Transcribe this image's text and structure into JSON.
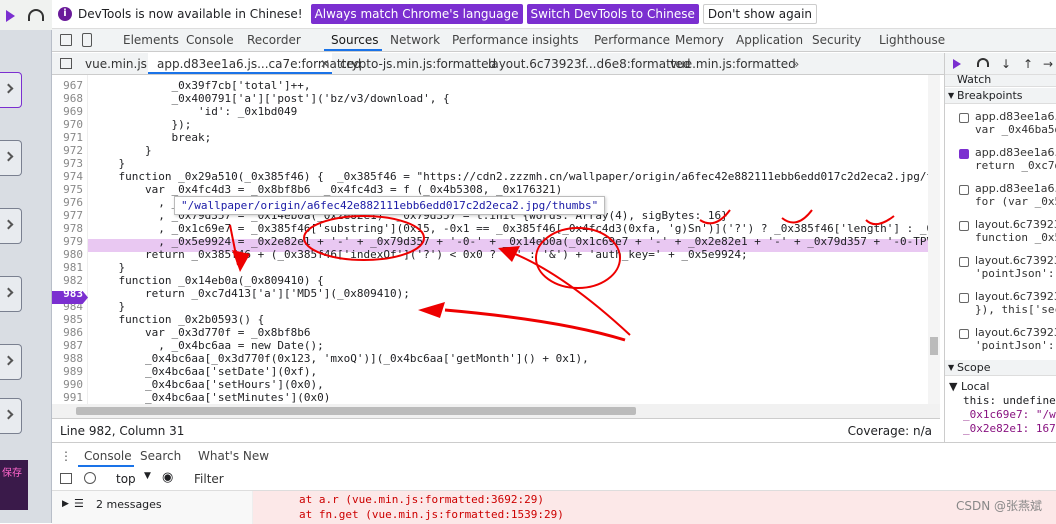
{
  "infobar": {
    "message": "DevTools is now available in Chinese!",
    "btn1": "Always match Chrome's language",
    "btn2": "Switch DevTools to Chinese",
    "btn3": "Don't show again"
  },
  "panels": [
    "Elements",
    "Console",
    "Recorder",
    "Sources",
    "Network",
    "Performance insights",
    "Performance",
    "Memory",
    "Application",
    "Security",
    "Lighthouse"
  ],
  "files": [
    "vue.min.js",
    "app.d83ee1a6.js...ca7e:formatted",
    "crypto-js.min.js:formatted",
    "layout.6c73923f...d6e8:formatted",
    "vue.min.js:formatted"
  ],
  "code": {
    "lines": [
      {
        "n": "967",
        "t": "            _0x39f7cb['total']++,"
      },
      {
        "n": "968",
        "t": "            _0x400791['a']['post']('bz/v3/download', {"
      },
      {
        "n": "969",
        "t": "                'id': _0x1bd049"
      },
      {
        "n": "970",
        "t": "            });"
      },
      {
        "n": "971",
        "t": "            break;"
      },
      {
        "n": "972",
        "t": "        }"
      },
      {
        "n": "973",
        "t": "    }"
      },
      {
        "n": "974",
        "t": "    function _0x29a510(_0x385f46) {  _0x385f46 = \"https://cdn2.zzzmh.cn/wallpaper/origin/a6fec42e882111ebb6edd017c2d2eca2.jpg/thumbs\""
      },
      {
        "n": "975",
        "t": "        var _0x4fc4d3 = _0x8bf8b6  _0x4fc4d3 = f (_0x4b5308, _0x176321)"
      },
      {
        "n": "976",
        "t": "          , _0x2e82e1 = +new Date() ... 73712000\""
      },
      {
        "n": "977",
        "t": "          , _0x79d357 = _0x14eb0a(_0x2e82e1)  _0x79d357 = t.init {words: Array(4), sigBytes: 16}"
      },
      {
        "n": "978",
        "t": "          , _0x1c69e7 = _0x385f46['substring'](0x15, -0x1 == _0x385f46[_0x4fc4d3(0xfa, 'g)Sn')]('?') ? _0x385f46['length'] : _0x385f46['l"
      },
      {
        "n": "979",
        "t": "          , _0x5e9924 = _0x2e82e1 + '-' + _0x79d357 + '-0-' + _0x14eb0a(_0x1c69e7 + '-' + _0x2e82e1 + '-' + _0x79d357 + '-0-TPV4hi7wIeM7D"
      },
      {
        "n": "980",
        "t": "        return _0x385f46 + (_0x385f46['indexOf']('?') < 0x0 ? '?' : '&') + 'auth_key=' + _0x5e9924;"
      },
      {
        "n": "981",
        "t": "    }"
      },
      {
        "n": "982",
        "t": "    function _0x14eb0a(_0x809410) {"
      },
      {
        "n": "983",
        "t": "        return _0xc7d413['a']['MD5'](_0x809410);"
      },
      {
        "n": "984",
        "t": "    }"
      },
      {
        "n": "985",
        "t": "    function _0x2b0593() {"
      },
      {
        "n": "986",
        "t": "        var _0x3d770f = _0x8bf8b6"
      },
      {
        "n": "987",
        "t": "          , _0x4bc6aa = new Date();"
      },
      {
        "n": "988",
        "t": "        _0x4bc6aa[_0x3d770f(0x123, 'mxoQ')](_0x4bc6aa['getMonth']() + 0x1),"
      },
      {
        "n": "989",
        "t": "        _0x4bc6aa['setDate'](0xf),"
      },
      {
        "n": "990",
        "t": "        _0x4bc6aa['setHours'](0x0),"
      },
      {
        "n": "991",
        "t": "        _0x4bc6aa['setMinutes'](0x0)"
      }
    ],
    "tooltip": "\"/wallpaper/origin/a6fec42e882111ebb6edd017c2d2eca2.jpg/thumbs\""
  },
  "status": {
    "position": "Line 982, Column 31",
    "coverage": "Coverage: n/a"
  },
  "right": {
    "watch": "Watch",
    "breakpoints": "Breakpoints",
    "items": [
      {
        "file": "app.d83ee1a6.js?_",
        "code": "var _0x46ba5d",
        "checked": false
      },
      {
        "file": "app.d83ee1a6.js?_",
        "code": "return _0xc7d4",
        "checked": true
      },
      {
        "file": "app.d83ee1a6.js?_",
        "code": "for (var _0x5",
        "checked": false
      },
      {
        "file": "layout.6c73923f.js",
        "code": "function _0x5b",
        "checked": false
      },
      {
        "file": "layout.6c73923f.js",
        "code": "'pointJson': t",
        "checked": false
      },
      {
        "file": "layout.6c73923f.js",
        "code": "}), this['secr",
        "checked": false
      },
      {
        "file": "layout.6c73923f.js",
        "code": "'pointJson': _",
        "checked": false
      }
    ],
    "scope": "Scope",
    "local": "Local",
    "vars": [
      "this: undefined",
      "_0x1c69e7: \"/wal",
      "_0x2e82e1: 1673"
    ]
  },
  "drawer": {
    "tabs": [
      "Console",
      "Search",
      "What's New"
    ],
    "context": "top",
    "filter": "Filter",
    "messages": "2 messages",
    "err1": "at a.r (vue.min.js:formatted:3692:29)",
    "err2": "at fn.get (vue.min.js:formatted:1539:29)"
  },
  "watermark": "CSDN @张燕斌",
  "sidebadge": "保存"
}
